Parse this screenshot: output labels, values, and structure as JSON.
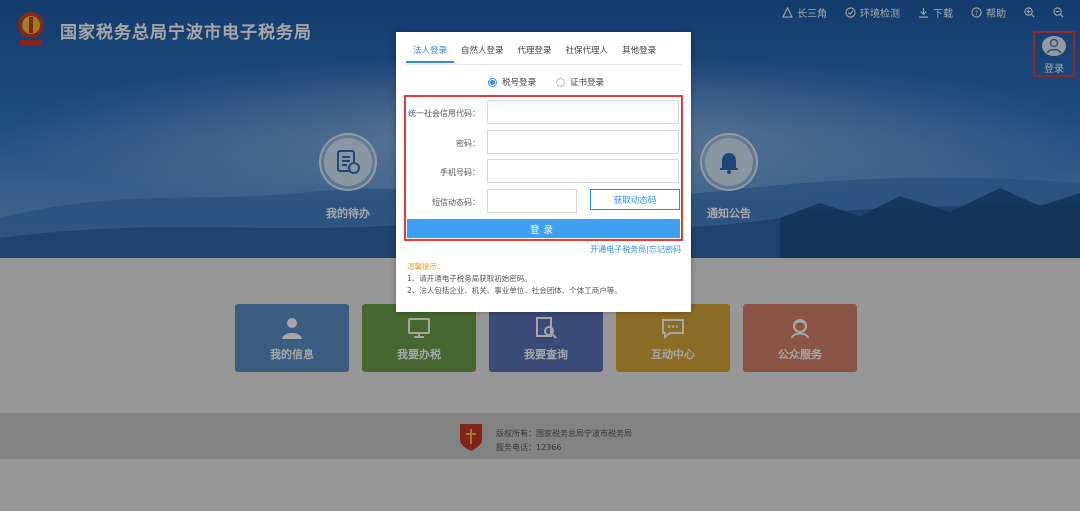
{
  "header": {
    "site_title": "国家税务总局宁波市电子税务局",
    "nav": [
      {
        "label": "长三角",
        "icon": "triangle-icon"
      },
      {
        "label": "环境检测",
        "icon": "check-env-icon"
      },
      {
        "label": "下载",
        "icon": "download-icon"
      },
      {
        "label": "帮助",
        "icon": "help-icon"
      }
    ],
    "login_label": "登录"
  },
  "hero": {
    "left_circle_label": "我的待办",
    "right_circle_label": "通知公告"
  },
  "tiles": [
    {
      "label": "我的信息",
      "color": "#5b90c8"
    },
    {
      "label": "我要办税",
      "color": "#6ca04a"
    },
    {
      "label": "我要查询",
      "color": "#5a73b8"
    },
    {
      "label": "互动中心",
      "color": "#d4a63a"
    },
    {
      "label": "公众服务",
      "color": "#d4836a"
    }
  ],
  "footer": {
    "copyright": "版权所有：国家税务总局宁波市税务局",
    "hotline": "服务电话：12366"
  },
  "modal": {
    "tabs": [
      "法人登录",
      "自然人登录",
      "代理登录",
      "社保代理人",
      "其他登录"
    ],
    "active_tab": 0,
    "radios": [
      {
        "label": "税号登录",
        "checked": true
      },
      {
        "label": "证书登录",
        "checked": false
      }
    ],
    "fields": [
      {
        "label": "统一社会信用代码：",
        "value": ""
      },
      {
        "label": "密码：",
        "value": ""
      },
      {
        "label": "手机号码：",
        "value": ""
      },
      {
        "label": "短信动态码：",
        "value": ""
      }
    ],
    "sms_button": "获取动态码",
    "submit": "登录",
    "link_open": "开通电子税务局",
    "link_sep": "|",
    "link_forgot": "忘记密码",
    "tips_title": "温馨提示：",
    "tips": [
      "1、请开通电子税务局获取初始密码。",
      "2、法人包括企业、机关、事业单位、社会团体、个体工商户等。"
    ]
  },
  "colors": {
    "accent": "#2f8be6",
    "highlight_box": "#e23b3b",
    "submit_bg": "#3f9ff0"
  }
}
